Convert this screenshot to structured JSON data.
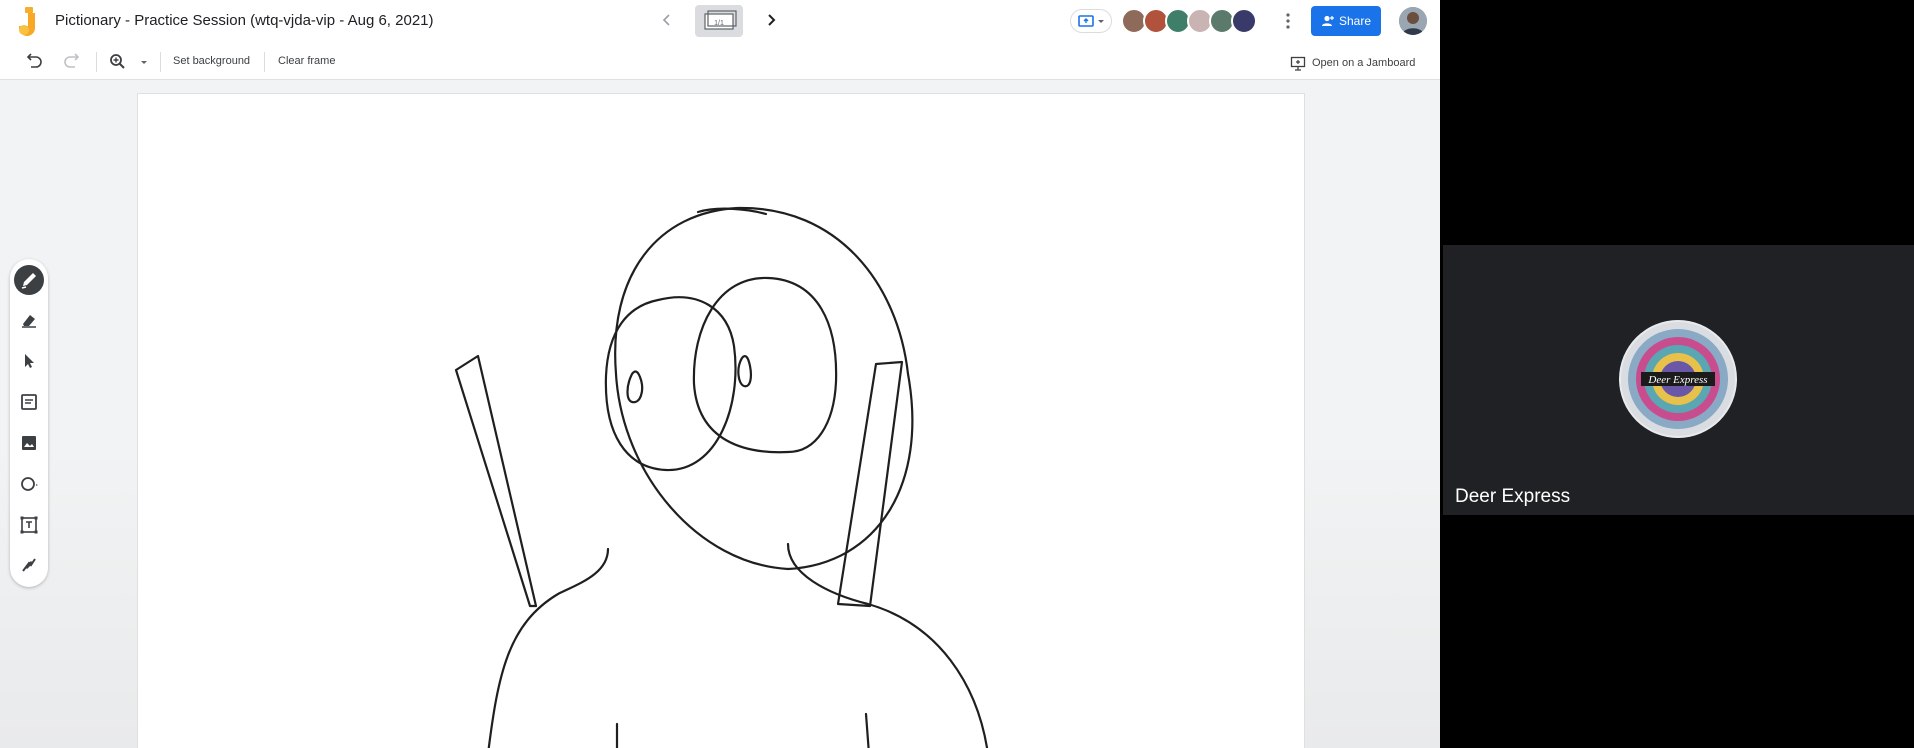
{
  "header": {
    "doc_title": "Pictionary - Practice Session (wtq-vjda-vip - Aug 6, 2021)",
    "frame_indicator": "1/1",
    "share_label": "Share",
    "participants": [
      {
        "name": "participant-1",
        "color": "#8e6a5a"
      },
      {
        "name": "participant-2",
        "color": "#b0523c"
      },
      {
        "name": "participant-3",
        "color": "#3f7f6a"
      },
      {
        "name": "participant-4",
        "color": "#c9b3b3"
      },
      {
        "name": "participant-5",
        "color": "#5c7a6b"
      },
      {
        "name": "participant-6",
        "color": "#3a3a6a"
      }
    ]
  },
  "toolbar": {
    "set_background": "Set background",
    "clear_frame": "Clear frame",
    "open_on_jamboard": "Open on a Jamboard"
  },
  "tools": [
    "pen-icon",
    "eraser-icon",
    "select-icon",
    "sticky-note-icon",
    "image-icon",
    "circle-icon",
    "text-box-icon",
    "laser-icon"
  ],
  "meet_tile": {
    "participant_name": "Deer Express",
    "avatar_text": "Deer Express"
  },
  "colors": {
    "brand_blue": "#1a73e8",
    "canvas_bg": "#ffffff",
    "app_bg": "#f1f3f4",
    "tile_bg": "#202124"
  }
}
